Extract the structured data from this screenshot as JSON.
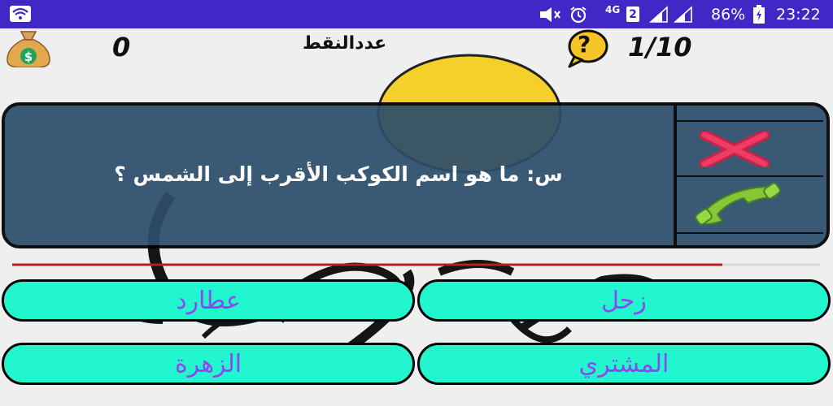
{
  "status_bar": {
    "network": "4G",
    "sim": "2",
    "battery": "86%",
    "time": "23:22"
  },
  "header": {
    "score": "0",
    "points_label": "عددالنقط",
    "help_symbol": "?",
    "progress": "1/10"
  },
  "question": {
    "text": "س: ما هو اسم الكوكب الأقرب إلى الشمس ؟"
  },
  "answers": [
    {
      "label": "زحل"
    },
    {
      "label": "عطارد"
    },
    {
      "label": "المشتري"
    },
    {
      "label": "الزهرة"
    }
  ],
  "colors": {
    "status_bar": "#3f28c6",
    "panel": "#2d4e6b",
    "answer_bg": "#22f6cf",
    "answer_text": "#8c48f0",
    "timer_line": "#b52020"
  }
}
